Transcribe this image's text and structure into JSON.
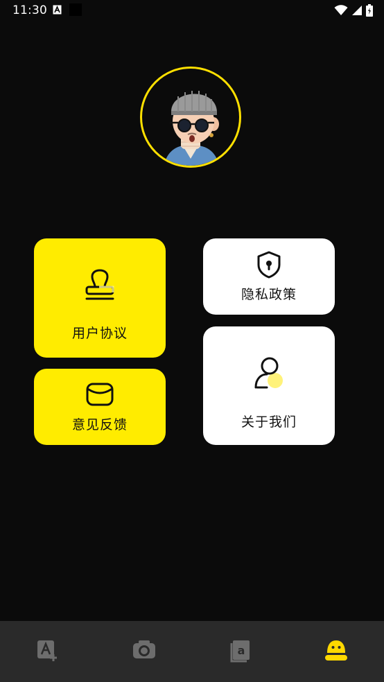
{
  "status_bar": {
    "time": "11:30",
    "icons": [
      "notification-a-icon",
      "app-black-square-icon",
      "wifi-icon",
      "signal-icon",
      "battery-icon"
    ]
  },
  "profile": {
    "avatar_icon": "avatar-3d-character",
    "accent_color": "#ffe000"
  },
  "cards": {
    "user_agreement": {
      "label": "用户协议",
      "icon": "stamp-icon",
      "color": "#ffec00"
    },
    "feedback": {
      "label": "意见反馈",
      "icon": "envelope-icon",
      "color": "#ffec00"
    },
    "privacy_policy": {
      "label": "隐私政策",
      "icon": "shield-lock-icon",
      "color": "#ffffff"
    },
    "about_us": {
      "label": "关于我们",
      "icon": "person-icon",
      "color": "#ffffff"
    }
  },
  "bottom_nav": {
    "items": [
      {
        "icon": "translate-add-icon",
        "active": false
      },
      {
        "icon": "camera-icon",
        "active": false
      },
      {
        "icon": "book-icon",
        "active": false
      },
      {
        "icon": "profile-face-icon",
        "active": true
      }
    ],
    "active_color": "#ffd800",
    "inactive_color": "#6d6d6d"
  }
}
